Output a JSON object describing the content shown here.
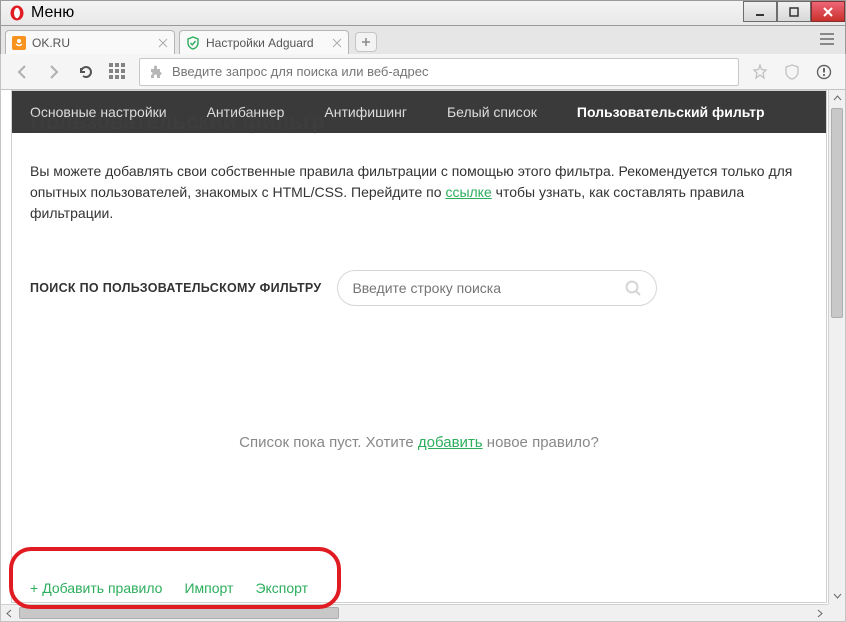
{
  "window": {
    "menu_label": "Меню"
  },
  "tabs": [
    {
      "title": "OK.RU",
      "favicon_color": "#f7931e"
    },
    {
      "title": "Настройки Adguard",
      "favicon_color": "#2cae5c"
    }
  ],
  "toolbar": {
    "url_placeholder": "Введите запрос для поиска или веб-адрес"
  },
  "adguard": {
    "nav": {
      "general": "Основные настройки",
      "antibanner": "Антибаннер",
      "antiphishing": "Антифишинг",
      "whitelist": "Белый список",
      "userfilter": "Пользовательский фильтр"
    },
    "ghost_title": "Пользовательский фильтр",
    "desc_part1": "Вы можете добавлять свои собственные правила фильтрации с помощью этого фильтра. Рекомендуется только для опытных пользователей, знакомых с HTML/CSS. Перейдите по ",
    "desc_link": "ссылке",
    "desc_part2": " чтобы узнать, как составлять правила фильтрации.",
    "search_label": "ПОИСК ПО ПОЛЬЗОВАТЕЛЬСКОМУ ФИЛЬТРУ",
    "search_placeholder": "Введите строку поиска",
    "empty_prefix": "Список пока пуст. Хотите ",
    "empty_link": "добавить",
    "empty_suffix": " новое правило?",
    "actions": {
      "add": "Добавить правило",
      "import": "Импорт",
      "export": "Экспорт"
    }
  }
}
